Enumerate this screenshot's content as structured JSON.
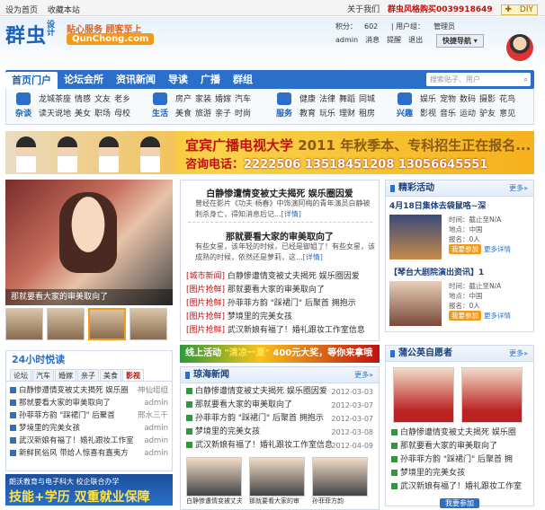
{
  "topbar": {
    "home": "设为首页",
    "fav": "收藏本站",
    "about": "关于我们",
    "hotline": "群虫风格购买0039918649",
    "diy": "DIY"
  },
  "logo": {
    "name": "群虫",
    "sub": "设计",
    "slogan": "贴心服务 顾客至上",
    "domain": "QunChong.com"
  },
  "user": {
    "points_label": "积分：",
    "points": "602",
    "group_label": "用户组：",
    "group": "管理员",
    "name": "admin",
    "msg": "消息",
    "remind": "提醒",
    "logout": "退出",
    "quicknav": "快捷导航"
  },
  "nav": {
    "items": [
      "首页门户",
      "论坛会所",
      "资讯新闻",
      "导读",
      "广播",
      "群组"
    ],
    "search_placeholder": "搜索贴子、用户"
  },
  "subnav": [
    {
      "label": "杂谈",
      "links": [
        "龙城茶座",
        "情感",
        "文友",
        "老乡",
        "读天说地",
        "美女",
        "职场",
        "母校"
      ]
    },
    {
      "label": "生活",
      "links": [
        "房产",
        "家装",
        "婚嫁",
        "汽车",
        "美食",
        "旅游",
        "亲子",
        "时尚"
      ]
    },
    {
      "label": "服务",
      "links": [
        "健康",
        "法律",
        "舞蹈",
        "同城",
        "教育",
        "玩乐",
        "理财",
        "租房"
      ]
    },
    {
      "label": "兴趣",
      "links": [
        "娱乐",
        "宠物",
        "数码",
        "摄影",
        "花鸟",
        "影视",
        "音乐",
        "运动",
        "驴友",
        "意见"
      ]
    }
  ],
  "banner": {
    "line1": "宜宾广播电视大学",
    "line1b": "2011 年秋季本、专科招生正在报名...",
    "line2": "咨询电话：",
    "phones": "2222506   13518451208   13056645551"
  },
  "hero": {
    "caption": "那就要看大家的审美取向了"
  },
  "hot24": {
    "title": "24小时悦读",
    "tabs": [
      "论坛",
      "汽车",
      "婚嫁",
      "亲子",
      "美食",
      "影视"
    ],
    "items": [
      {
        "t": "白静惨遭情变被丈夫揭死 娱乐圈",
        "d": "神仙组组"
      },
      {
        "t": "那就要看大家的审美取向了",
        "d": "admin"
      },
      {
        "t": "孙菲菲方韵 \"踩裙门\" 后聚首",
        "d": "邢水三千"
      },
      {
        "t": "梦境里的完美女孩",
        "d": "admin"
      },
      {
        "t": "武汉新娘有福了！婚礼跟妆工作室",
        "d": "admin"
      },
      {
        "t": "新鲜民俗风 带给人惊喜有嘉夷方",
        "d": "admin"
      }
    ]
  },
  "bottomad": {
    "line1": "朗沃教育与电子科大 校企联合办学",
    "line2": "技能+学历 双重就业保障"
  },
  "news": {
    "h1": "白静惨遭情变被丈夫揭死 娱乐圈因爱",
    "p1": "曾经在影片《功夫·杨春》中饰演阿梅的青年演员白静被刺杀身亡，得知消息后记...",
    "more": "[详情]",
    "h2": "那就要看大家的审美取向了",
    "p2": "有些女星，该年轻的时候，已经是御姐了！有些女星，该成熟的时候，依然还是萝莉，这...",
    "list": [
      {
        "tag": "[城市新闻]",
        "t": "白静惨遭情变被丈夫揭死 娱乐圈因爱"
      },
      {
        "tag": "[图片抢鲜]",
        "t": "那就要看大家的审美取向了"
      },
      {
        "tag": "[图片抢鲜]",
        "t": "孙菲菲方韵 \"踩裙门\" 后聚首 拥抱示"
      },
      {
        "tag": "[图片抢鲜]",
        "t": "梦境里的完美女孩"
      },
      {
        "tag": "[图片抢鲜]",
        "t": "武汉新娘有福了！婚礼跟妆工作室信息"
      }
    ]
  },
  "adstrip": {
    "a": "线上活动",
    "b": "\"清凉一夏\"",
    "c": "400元大奖，等你来拿哦"
  },
  "qh": {
    "title": "琼海新闻",
    "more": "更多»",
    "items": [
      {
        "t": "白静惨遭情变被丈夫揭死 娱乐圈因爱",
        "d": "2012-03-03"
      },
      {
        "t": "那就要看大家的审美取向了",
        "d": "2012-03-07"
      },
      {
        "t": "孙菲菲方韵 \"踩裙门\" 后聚首 拥抱示",
        "d": "2012-03-07"
      },
      {
        "t": "梦境里的完美女孩",
        "d": "2012-03-08"
      },
      {
        "t": "武汉新娘有福了！婚礼跟妆工作室信息",
        "d": "2012-04-09"
      }
    ],
    "imgs": [
      "白静惨遭情变被丈夫",
      "那就要看大家的审",
      "孙菲菲方韵"
    ]
  },
  "act": {
    "title": "精彩活动",
    "more": "更多»",
    "events": [
      {
        "t": "4月18日集体去袋鼠咯~深",
        "time": "时间：截止至N/A",
        "place": "地点：中国",
        "count": "报名：0人",
        "join": "我要参加",
        "detail": "更多详情"
      },
      {
        "t": "【琴台大剧院演出资讯】1",
        "time": "时间：截止至N/A",
        "place": "地点：中国",
        "count": "报名：0人",
        "join": "我要参加",
        "detail": "更多详情"
      }
    ]
  },
  "pu": {
    "title": "蒲公英自愿者",
    "more": "更多»",
    "items": [
      "白静惨遭情变被丈夫揭死 娱乐圈",
      "那就要看大家的审美取向了",
      "孙菲菲方韵 \"踩裙门\" 后聚首 拥",
      "梦境里的完美女孩",
      "武汉新娘有福了！婚礼跟妆工作室"
    ],
    "join": "我要参加"
  }
}
